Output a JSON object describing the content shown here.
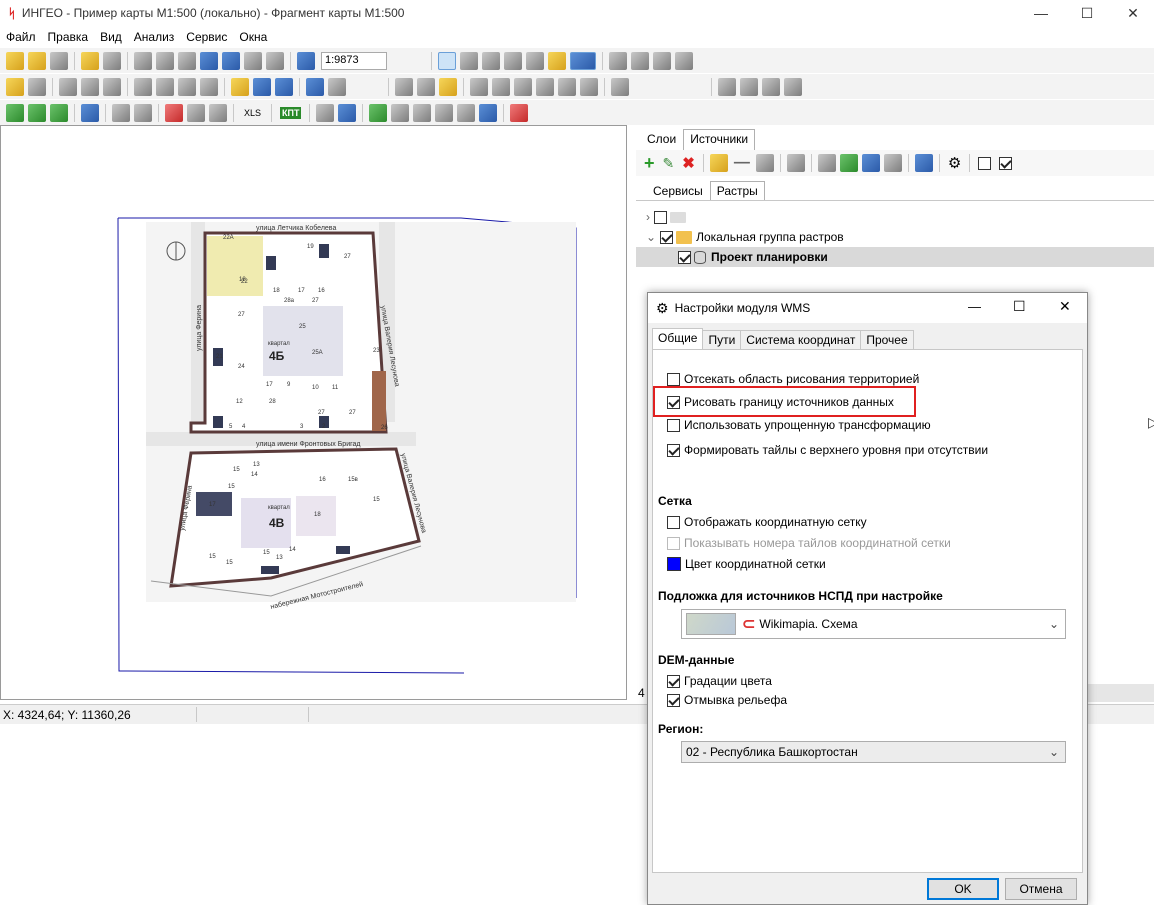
{
  "window": {
    "title": "ИНГЕО - Пример карты М1:500 (локально) - Фрагмент карты М1:500"
  },
  "menu": [
    "Файл",
    "Правка",
    "Вид",
    "Анализ",
    "Сервис",
    "Окна"
  ],
  "toolbar": {
    "scale": "1:9873",
    "xls_label": "XLS",
    "kpt_label": "КПТ"
  },
  "status": {
    "coords": "X: 4324,64; Y: 11360,26"
  },
  "map": {
    "street_top": "улица Летчика Кобелева",
    "street_mid": "улица имени Фронтовых Бригад",
    "street_bottom": "набережная Мотостроителей",
    "street_left1": "улица Ферина",
    "street_left2": "улица Ферина",
    "street_right1": "улица Валерия Лесунова",
    "street_right2": "улица Валерия Лесунова",
    "block1_label": "квартал",
    "block1_name": "4Б",
    "block2_label": "квартал",
    "block2_name": "4В",
    "lots": [
      "22А",
      "19",
      "18",
      "27",
      "22",
      "18",
      "17",
      "16",
      "28а",
      "27",
      "27",
      "25",
      "25А",
      "21",
      "24",
      "23",
      "17",
      "9",
      "10",
      "11",
      "12",
      "28",
      "27",
      "27",
      "5",
      "4",
      "3",
      "2",
      "26",
      "13",
      "15",
      "14",
      "16",
      "17",
      "15",
      "15в",
      "15",
      "15",
      "14",
      "15",
      "13",
      "18",
      "15"
    ]
  },
  "panel": {
    "tabs": [
      "Слои",
      "Источники"
    ],
    "subtabs": [
      "Сервисы",
      "Растры"
    ],
    "tree": {
      "group": "Локальная группа растров",
      "item": "Проект планировки"
    }
  },
  "dialog": {
    "title": "Настройки модуля WMS",
    "tabs": [
      "Общие",
      "Пути",
      "Система координат",
      "Прочее"
    ],
    "options": [
      {
        "label": "Отсекать область рисования территорией",
        "checked": false
      },
      {
        "label": "Рисовать границу источников данных",
        "checked": true
      },
      {
        "label": "Использовать упрощенную трансформацию",
        "checked": false
      },
      {
        "label": "Формировать тайлы с верхнего уровня при отсутствии",
        "checked": true
      }
    ],
    "grid_section": "Сетка",
    "grid_options": [
      {
        "label": "Отображать координатную сетку",
        "checked": false
      },
      {
        "label": "Показывать номера тайлов координатной сетки",
        "checked": false,
        "disabled": true
      },
      {
        "label": "Цвет координатной сетки",
        "color": "#0000ff"
      }
    ],
    "substrate_section": "Подложка для источников  НСПД  при настройке",
    "substrate_value": "Wikimapia. Схема",
    "dem_section": "DEM-данные",
    "dem_options": [
      {
        "label": "Градации цвета",
        "checked": true
      },
      {
        "label": "Отмывка рельефа",
        "checked": true
      }
    ],
    "region_section": "Регион:",
    "region_value": "02 - Республика Башкортостан",
    "ok": "OK",
    "cancel": "Отмена"
  },
  "misc": {
    "side_digit": "4"
  }
}
